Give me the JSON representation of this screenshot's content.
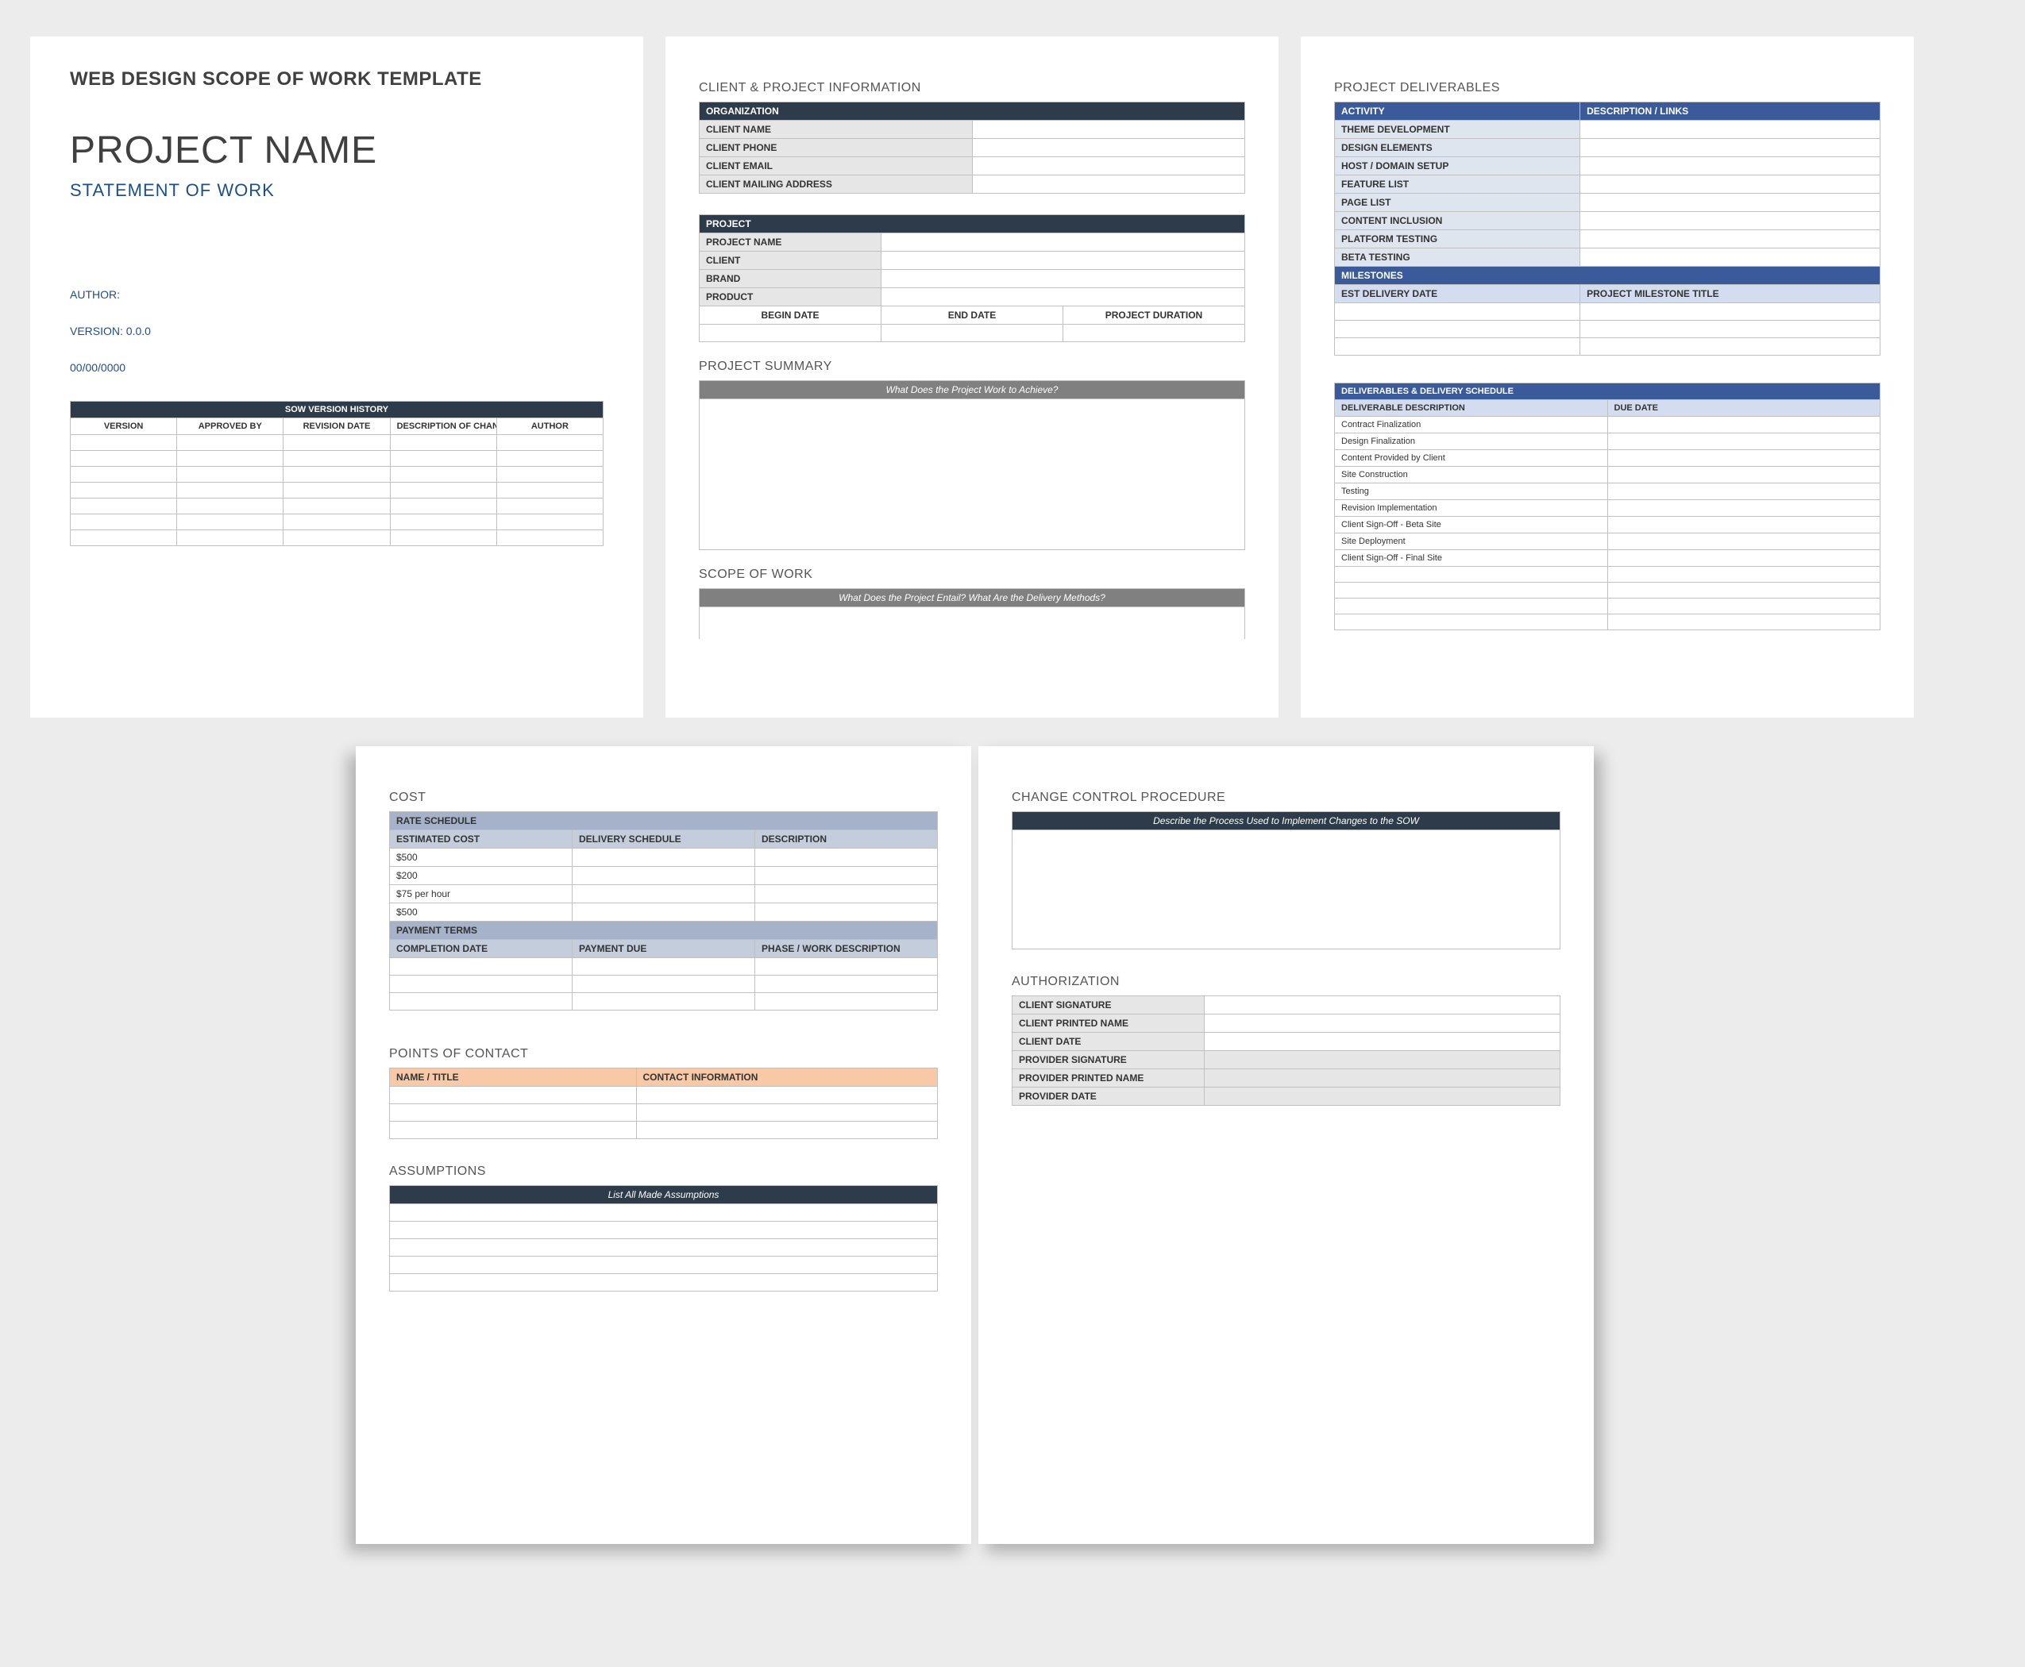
{
  "cover": {
    "template_title": "WEB DESIGN SCOPE OF WORK TEMPLATE",
    "project_name": "PROJECT NAME",
    "subtitle": "STATEMENT OF WORK",
    "author_label": "AUTHOR:",
    "version_label": "VERSION: 0.0.0",
    "date_label": "00/00/0000",
    "history_title": "SOW VERSION HISTORY",
    "history_cols": [
      "VERSION",
      "APPROVED BY",
      "REVISION DATE",
      "DESCRIPTION OF CHANGE",
      "AUTHOR"
    ]
  },
  "client_proj": {
    "section": "CLIENT & PROJECT INFORMATION",
    "org_header": "ORGANIZATION",
    "org_rows": [
      "CLIENT NAME",
      "CLIENT  PHONE",
      "CLIENT EMAIL",
      "CLIENT MAILING ADDRESS"
    ],
    "proj_header": "PROJECT",
    "proj_rows": [
      "PROJECT NAME",
      "CLIENT",
      "BRAND",
      "PRODUCT"
    ],
    "date_cols": [
      "BEGIN DATE",
      "END DATE",
      "PROJECT DURATION"
    ],
    "summary_title": "PROJECT SUMMARY",
    "summary_prompt": "What Does the Project Work to Achieve?",
    "scope_title": "SCOPE OF WORK",
    "scope_prompt": "What Does the Project Entail? What Are the Delivery Methods?"
  },
  "deliverables": {
    "section": "PROJECT DELIVERABLES",
    "cols": [
      "ACTIVITY",
      "DESCRIPTION / LINKS"
    ],
    "activities": [
      "THEME DEVELOPMENT",
      "DESIGN ELEMENTS",
      "HOST / DOMAIN SETUP",
      "FEATURE LIST",
      "PAGE LIST",
      "CONTENT INCLUSION",
      "PLATFORM TESTING",
      "BETA TESTING"
    ],
    "milestones_header": "MILESTONES",
    "milestone_cols": [
      "EST DELIVERY DATE",
      "PROJECT MILESTONE TITLE"
    ],
    "schedule_header": "DELIVERABLES & DELIVERY SCHEDULE",
    "schedule_cols": [
      "DELIVERABLE DESCRIPTION",
      "DUE DATE"
    ],
    "schedule_rows": [
      "Contract Finalization",
      "Design Finalization",
      "Content Provided by Client",
      "Site Construction",
      "Testing",
      "Revision Implementation",
      "Client Sign-Off - Beta Site",
      "Site Deployment",
      "Client Sign-Off - Final Site"
    ]
  },
  "cost": {
    "section": "COST",
    "rate_header": "RATE SCHEDULE",
    "rate_cols": [
      "ESTIMATED COST",
      "DELIVERY SCHEDULE",
      "DESCRIPTION"
    ],
    "rate_rows": [
      "$500",
      "$200",
      "$75 per hour",
      "$500"
    ],
    "pay_header": "PAYMENT TERMS",
    "pay_cols": [
      "COMPLETION DATE",
      "PAYMENT DUE",
      "PHASE / WORK DESCRIPTION"
    ]
  },
  "contacts": {
    "section": "POINTS OF CONTACT",
    "cols": [
      "NAME / TITLE",
      "CONTACT INFORMATION"
    ]
  },
  "assumptions": {
    "section": "ASSUMPTIONS",
    "prompt": "List All Made Assumptions"
  },
  "change": {
    "section": "CHANGE CONTROL PROCEDURE",
    "prompt": "Describe the Process Used to Implement Changes to the SOW"
  },
  "auth": {
    "section": "AUTHORIZATION",
    "rows": [
      "CLIENT SIGNATURE",
      "CLIENT PRINTED NAME",
      "CLIENT DATE",
      "PROVIDER SIGNATURE",
      "PROVIDER PRINTED NAME",
      "PROVIDER DATE"
    ]
  }
}
